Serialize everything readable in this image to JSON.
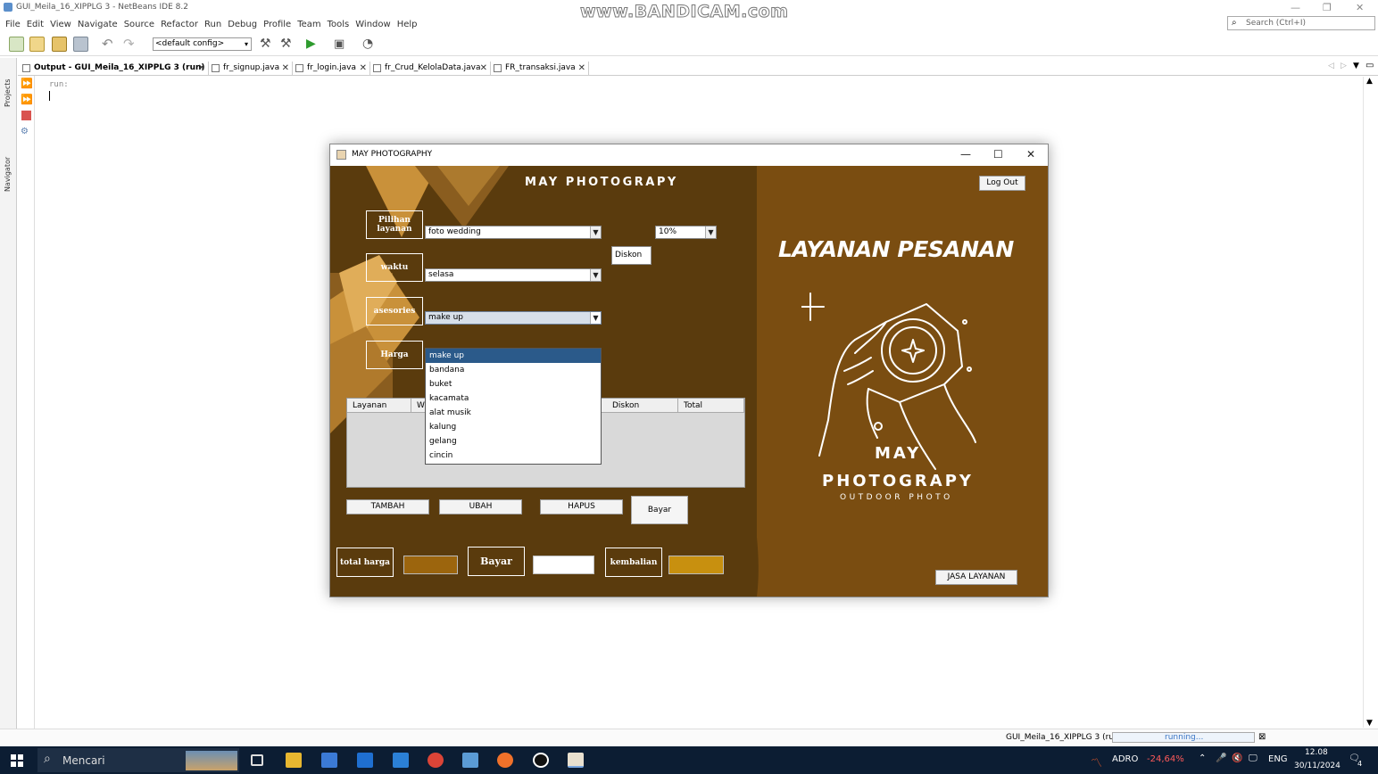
{
  "ide": {
    "window_title": "GUI_Meila_16_XIPPLG 3 - NetBeans IDE 8.2",
    "watermark": "www.BANDICAM.com",
    "menu": [
      "File",
      "Edit",
      "View",
      "Navigate",
      "Source",
      "Refactor",
      "Run",
      "Debug",
      "Profile",
      "Team",
      "Tools",
      "Window",
      "Help"
    ],
    "search_placeholder": "Search (Ctrl+I)",
    "config": "<default config>",
    "side_tabs": [
      "Projects",
      "Navigator"
    ],
    "tabs": [
      {
        "label": "Output - GUI_Meila_16_XIPPLG 3 (run)",
        "active": true
      },
      {
        "label": "fr_signup.java"
      },
      {
        "label": "fr_login.java"
      },
      {
        "label": "fr_Crud_KelolaData.java"
      },
      {
        "label": "FR_transaksi.java"
      }
    ],
    "console_text": "run:",
    "status_project": "GUI_Meila_16_XIPPLG 3 (run)",
    "status_running": "running..."
  },
  "taskbar": {
    "search_label": "Mencari",
    "stock_ticker": "ADRO",
    "stock_change": "-24,64%",
    "language": "ENG",
    "time": "12.08",
    "date": "30/11/2024",
    "notification_count": "4"
  },
  "app": {
    "title": "MAY PHOTOGRAPHY",
    "heading": "MAY PHOTOGRAPY",
    "labels": {
      "pilihan_layanan": "Pilihan layanan",
      "waktu": "waktu",
      "asesories": "asesories",
      "harga": "Harga",
      "total_harga": "total harga",
      "bayar": "Bayar",
      "kembalian": "kembalian"
    },
    "combo_layanan": "foto wedding",
    "combo_waktu": "selasa",
    "combo_asesories": "make up",
    "diskon_label": "Diskon",
    "combo_diskon": "10%",
    "dropdown_items": [
      "make up",
      "bandana",
      "buket",
      "kacamata",
      "alat musik",
      "kalung",
      "gelang",
      "cincin"
    ],
    "table_columns": [
      "Layanan",
      "W",
      "Diskon",
      "Total"
    ],
    "buttons": {
      "tambah": "TAMBAH",
      "ubah": "UBAH",
      "hapus": "HAPUS",
      "bayar": "Bayar",
      "logout": "Log Out",
      "jasa": "JASA LAYANAN"
    },
    "right_title": "LAYANAN PESANAN",
    "logo_may": "MAY",
    "logo_photograpy": "PHOTOGRAPY",
    "logo_sub": "OUTDOOR PHOTO",
    "colors": {
      "dark_brown": "#5a3b0d",
      "brown": "#7a4d11",
      "accent_gold": "#c9913a",
      "selection": "#2b5a8a"
    }
  }
}
